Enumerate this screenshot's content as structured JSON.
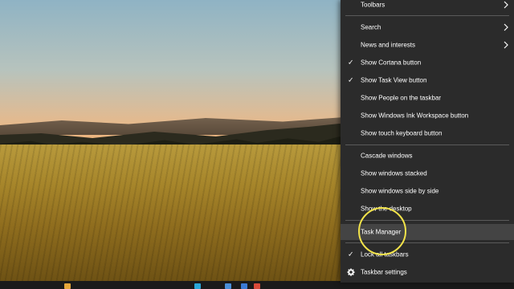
{
  "menu": {
    "items": [
      {
        "label": "Toolbars",
        "checked": false,
        "submenu": true
      },
      {
        "label": "Search",
        "checked": false,
        "submenu": true
      },
      {
        "label": "News and interests",
        "checked": false,
        "submenu": true
      },
      {
        "label": "Show Cortana button",
        "checked": true,
        "submenu": false
      },
      {
        "label": "Show Task View button",
        "checked": true,
        "submenu": false
      },
      {
        "label": "Show People on the taskbar",
        "checked": false,
        "submenu": false
      },
      {
        "label": "Show Windows Ink Workspace button",
        "checked": false,
        "submenu": false
      },
      {
        "label": "Show touch keyboard button",
        "checked": false,
        "submenu": false
      },
      {
        "label": "Cascade windows",
        "checked": false,
        "submenu": false
      },
      {
        "label": "Show windows stacked",
        "checked": false,
        "submenu": false
      },
      {
        "label": "Show windows side by side",
        "checked": false,
        "submenu": false
      },
      {
        "label": "Show the desktop",
        "checked": false,
        "submenu": false
      },
      {
        "label": "Task Manager",
        "checked": false,
        "submenu": false,
        "highlighted": true
      },
      {
        "label": "Lock all taskbars",
        "checked": true,
        "submenu": false
      },
      {
        "label": "Taskbar settings",
        "checked": false,
        "submenu": false,
        "icon": "gear-icon"
      }
    ],
    "check_glyph": "✓"
  },
  "colors": {
    "menu_bg": "#2b2b2b",
    "menu_text": "#ffffff",
    "highlight_bg": "#444444",
    "cursor_ring": "#f2e34a"
  },
  "taskbar": {
    "icons": [
      "app-icon",
      "edge-icon",
      "store-icon",
      "mail-icon",
      "chrome-icon"
    ]
  }
}
